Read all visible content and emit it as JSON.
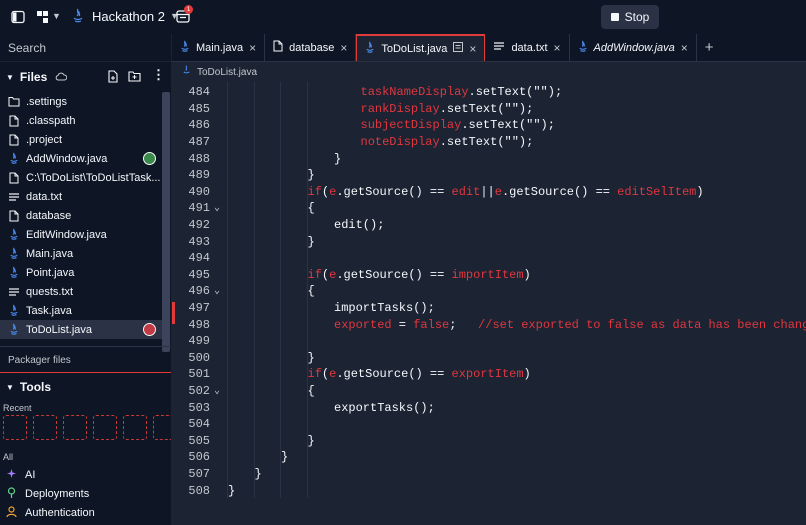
{
  "app": {
    "project_name": "Hackathon 2",
    "notification_count": "1",
    "stop_label": "Stop"
  },
  "sidebar": {
    "search_label": "Search",
    "files_title": "Files",
    "files": [
      {
        "name": ".settings",
        "icon": "folder-icon"
      },
      {
        "name": ".classpath",
        "icon": "file-icon"
      },
      {
        "name": ".project",
        "icon": "file-icon"
      },
      {
        "name": "AddWindow.java",
        "icon": "java-icon",
        "badge": "user-avatar-green"
      },
      {
        "name": "C:\\ToDoList\\ToDoListTask...",
        "icon": "file-icon"
      },
      {
        "name": "data.txt",
        "icon": "text-file-icon"
      },
      {
        "name": "database",
        "icon": "file-icon"
      },
      {
        "name": "EditWindow.java",
        "icon": "java-icon"
      },
      {
        "name": "Main.java",
        "icon": "java-icon"
      },
      {
        "name": "Point.java",
        "icon": "java-icon"
      },
      {
        "name": "quests.txt",
        "icon": "text-file-icon"
      },
      {
        "name": "Task.java",
        "icon": "java-icon"
      },
      {
        "name": "ToDoList.java",
        "icon": "java-icon",
        "badge": "user-avatar-red",
        "active": true
      }
    ],
    "packager_label": "Packager files",
    "tools_title": "Tools",
    "recent_label": "Recent",
    "all_label": "All",
    "tools": [
      {
        "label": "AI",
        "icon": "ai-icon"
      },
      {
        "label": "Deployments",
        "icon": "deployments-icon"
      },
      {
        "label": "Authentication",
        "icon": "auth-icon"
      }
    ]
  },
  "editor": {
    "tabs": [
      {
        "label": "Main.java",
        "icon": "java-icon",
        "active": false,
        "italic": false
      },
      {
        "label": "database",
        "icon": "file-icon",
        "active": false,
        "italic": false
      },
      {
        "label": "ToDoList.java",
        "icon": "java-icon",
        "active": true,
        "italic": false
      },
      {
        "label": "data.txt",
        "icon": "text-file-icon",
        "active": false,
        "italic": false
      },
      {
        "label": "AddWindow.java",
        "icon": "java-icon",
        "active": false,
        "italic": true
      }
    ],
    "breadcrumb": "ToDoList.java",
    "lines": [
      {
        "n": "484",
        "fold": "",
        "indent": 5,
        "code": [
          [
            "t-red",
            "taskNameDisplay"
          ],
          [
            "t-fn",
            ".setText(\"\");"
          ]
        ]
      },
      {
        "n": "485",
        "fold": "",
        "indent": 5,
        "code": [
          [
            "t-red",
            "rankDisplay"
          ],
          [
            "t-fn",
            ".setText(\"\");"
          ]
        ]
      },
      {
        "n": "486",
        "fold": "",
        "indent": 5,
        "code": [
          [
            "t-red",
            "subjectDisplay"
          ],
          [
            "t-fn",
            ".setText(\"\");"
          ]
        ]
      },
      {
        "n": "487",
        "fold": "",
        "indent": 5,
        "code": [
          [
            "t-red",
            "noteDisplay"
          ],
          [
            "t-fn",
            ".setText(\"\");"
          ]
        ]
      },
      {
        "n": "488",
        "fold": "",
        "indent": 4,
        "code": [
          [
            "t-fn",
            "}"
          ]
        ]
      },
      {
        "n": "489",
        "fold": "",
        "indent": 3,
        "code": [
          [
            "t-fn",
            "}"
          ]
        ]
      },
      {
        "n": "490",
        "fold": "",
        "indent": 3,
        "code": [
          [
            "t-red",
            "if"
          ],
          [
            "t-fn",
            "("
          ],
          [
            "t-red",
            "e"
          ],
          [
            "t-fn",
            ".getSource() == "
          ],
          [
            "t-red",
            "edit"
          ],
          [
            "t-fn",
            "||"
          ],
          [
            "t-red",
            "e"
          ],
          [
            "t-fn",
            ".getSource() == "
          ],
          [
            "t-red",
            "editSelItem"
          ],
          [
            "t-fn",
            ")"
          ]
        ]
      },
      {
        "n": "491",
        "fold": "v",
        "indent": 3,
        "code": [
          [
            "t-fn",
            "{"
          ]
        ]
      },
      {
        "n": "492",
        "fold": "",
        "indent": 4,
        "code": [
          [
            "t-fn",
            "edit();"
          ]
        ]
      },
      {
        "n": "493",
        "fold": "",
        "indent": 3,
        "code": [
          [
            "t-fn",
            "}"
          ]
        ]
      },
      {
        "n": "494",
        "fold": "",
        "indent": 0,
        "code": []
      },
      {
        "n": "495",
        "fold": "",
        "indent": 3,
        "code": [
          [
            "t-red",
            "if"
          ],
          [
            "t-fn",
            "("
          ],
          [
            "t-red",
            "e"
          ],
          [
            "t-fn",
            ".getSource() == "
          ],
          [
            "t-red",
            "importItem"
          ],
          [
            "t-fn",
            ")"
          ]
        ]
      },
      {
        "n": "496",
        "fold": "v",
        "indent": 3,
        "code": [
          [
            "t-fn",
            "{"
          ]
        ]
      },
      {
        "n": "497",
        "fold": "",
        "indent": 4,
        "code": [
          [
            "t-fn",
            "importTasks();"
          ]
        ]
      },
      {
        "n": "498",
        "fold": "",
        "indent": 4,
        "code": [
          [
            "t-red",
            "exported"
          ],
          [
            "t-fn",
            " = "
          ],
          [
            "t-red",
            "false"
          ],
          [
            "t-fn",
            ";   "
          ],
          [
            "t-comment",
            "//set exported to false as data has been changed"
          ]
        ]
      },
      {
        "n": "499",
        "fold": "",
        "indent": 0,
        "code": []
      },
      {
        "n": "500",
        "fold": "",
        "indent": 3,
        "code": [
          [
            "t-fn",
            "}"
          ]
        ]
      },
      {
        "n": "501",
        "fold": "",
        "indent": 3,
        "code": [
          [
            "t-red",
            "if"
          ],
          [
            "t-fn",
            "("
          ],
          [
            "t-red",
            "e"
          ],
          [
            "t-fn",
            ".getSource() == "
          ],
          [
            "t-red",
            "exportItem"
          ],
          [
            "t-fn",
            ")"
          ]
        ]
      },
      {
        "n": "502",
        "fold": "v",
        "indent": 3,
        "code": [
          [
            "t-fn",
            "{"
          ]
        ]
      },
      {
        "n": "503",
        "fold": "",
        "indent": 4,
        "code": [
          [
            "t-fn",
            "exportTasks();"
          ]
        ]
      },
      {
        "n": "504",
        "fold": "",
        "indent": 0,
        "code": []
      },
      {
        "n": "505",
        "fold": "",
        "indent": 3,
        "code": [
          [
            "t-fn",
            "}"
          ]
        ]
      },
      {
        "n": "506",
        "fold": "",
        "indent": 2,
        "code": [
          [
            "t-fn",
            "}"
          ]
        ]
      },
      {
        "n": "507",
        "fold": "",
        "indent": 1,
        "code": [
          [
            "t-fn",
            "}"
          ]
        ]
      },
      {
        "n": "508",
        "fold": "",
        "indent": 0,
        "code": [
          [
            "t-fn",
            "}"
          ]
        ]
      }
    ]
  },
  "colors": {
    "background": "#0e1525",
    "editor_bg": "#1c2333",
    "accent_red": "#e0373e",
    "text": "#f5f9fc"
  }
}
